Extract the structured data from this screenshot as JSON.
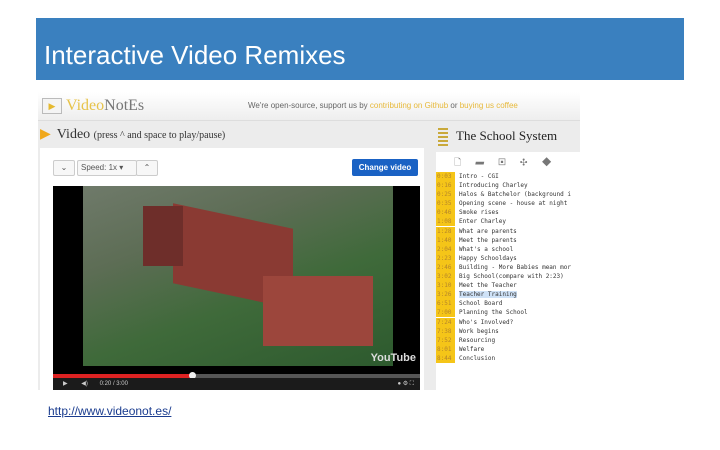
{
  "slide": {
    "title": "Interactive Video Remixes",
    "link": "http://www.videonot.es/"
  },
  "app": {
    "logo_a": "Video",
    "logo_b": "NotEs",
    "promo_text": "We're open-source, support us by ",
    "promo_link1": "contributing on Github",
    "promo_or": " or ",
    "promo_link2": "buying us coffee"
  },
  "video": {
    "title": "Video",
    "hint": "(press ^ and space to play/pause)",
    "speed": "Speed: 1x",
    "change_label": "Change video",
    "time": "0:20 / 3:00",
    "progress": 0.38,
    "brand": "YouTube"
  },
  "notes": {
    "title": "The School System",
    "items": [
      {
        "t": "0:03",
        "text": "Intro - CGI"
      },
      {
        "t": "0:16",
        "text": "Introducing Charley"
      },
      {
        "t": "0:25",
        "text": "Halos & Batchelor (background i"
      },
      {
        "t": "0:35",
        "text": "Opening scene - house at night"
      },
      {
        "t": "0:46",
        "text": "Smoke rises"
      },
      {
        "t": "1:08",
        "text": "Enter Charley"
      },
      {
        "t": "1:28",
        "text": "What are parents"
      },
      {
        "t": "1:40",
        "text": "Meet the parents"
      },
      {
        "t": "2:04",
        "text": "What's a school"
      },
      {
        "t": "2:23",
        "text": "Happy Schooldays"
      },
      {
        "t": "2:46",
        "text": "Building - More Babies mean mor"
      },
      {
        "t": "3:02",
        "text": "Big School(compare with 2:23)"
      },
      {
        "t": "3:10",
        "text": "Meet the Teacher"
      },
      {
        "t": "3:26",
        "text": "Teacher Training"
      },
      {
        "t": "6:51",
        "text": "School Board"
      },
      {
        "t": "7:00",
        "text": "Planning the School"
      },
      {
        "t": "7:24",
        "text": "Who's Involved?"
      },
      {
        "t": "7:38",
        "text": "Work begins"
      },
      {
        "t": "7:52",
        "text": "Resourcing"
      },
      {
        "t": "8:01",
        "text": "Welfare"
      },
      {
        "t": "8:44",
        "text": "Conclusion"
      }
    ]
  }
}
